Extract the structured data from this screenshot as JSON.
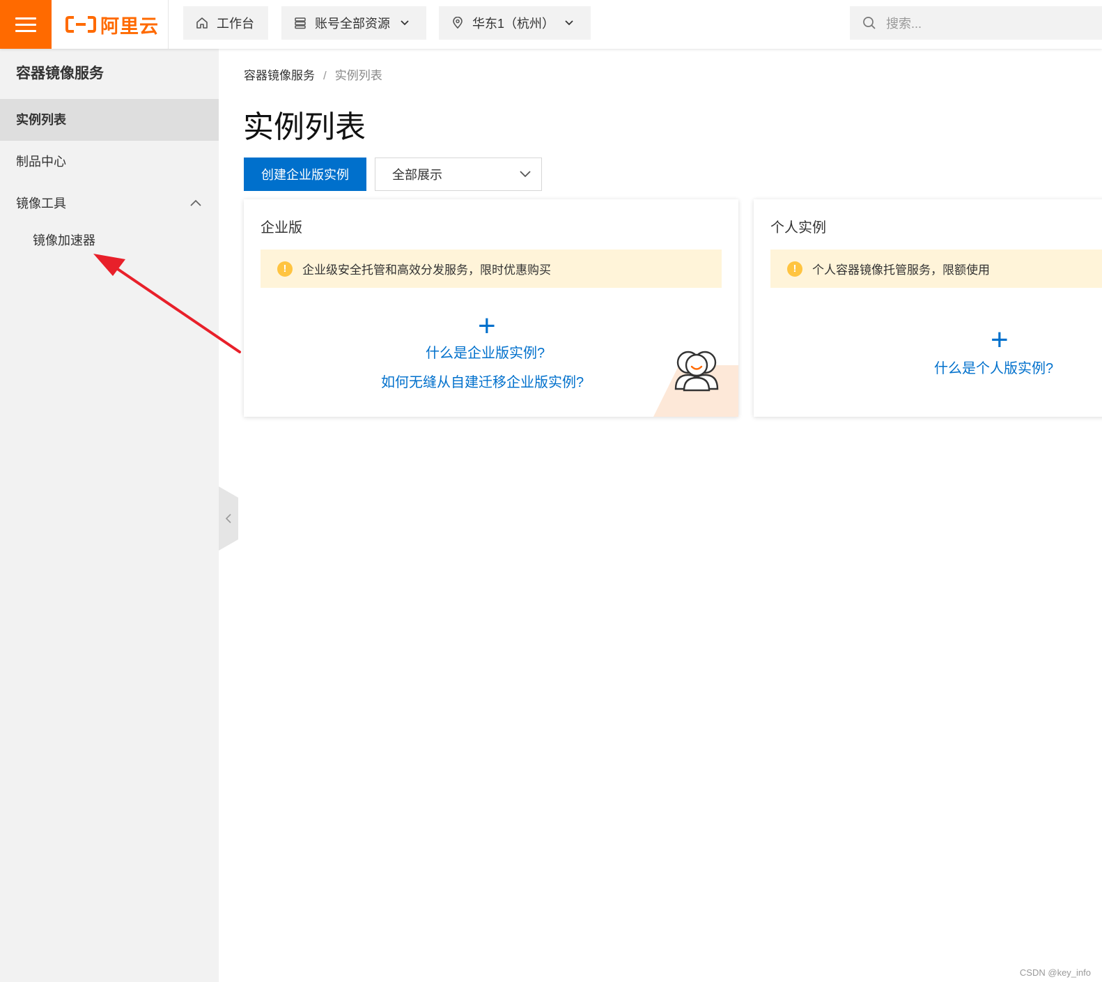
{
  "topbar": {
    "brand": "阿里云",
    "workbench": "工作台",
    "resources": "账号全部资源",
    "region": "华东1（杭州）",
    "search_placeholder": "搜索..."
  },
  "sidebar": {
    "title": "容器镜像服务",
    "items": [
      {
        "label": "实例列表",
        "active": true
      },
      {
        "label": "制品中心",
        "active": false
      },
      {
        "label": "镜像工具",
        "active": false,
        "expanded": true
      }
    ],
    "subitems": [
      {
        "label": "镜像加速器"
      }
    ]
  },
  "breadcrumb": {
    "root": "容器镜像服务",
    "separator": "/",
    "current": "实例列表"
  },
  "page": {
    "title": "实例列表",
    "create_button": "创建企业版实例",
    "filter_value": "全部展示"
  },
  "cards": {
    "enterprise": {
      "title": "企业版",
      "notice": "企业级安全托管和高效分发服务，限时优惠购买",
      "link1": "什么是企业版实例?",
      "link2": "如何无缝从自建迁移企业版实例?"
    },
    "personal": {
      "title": "个人实例",
      "notice": "个人容器镜像托管服务，限额使用",
      "link1": "什么是个人版实例?"
    }
  },
  "watermark": "CSDN @key_info",
  "colors": {
    "brand": "#ff6a00",
    "primary": "#0070cc",
    "notice_bg": "#fff4d9",
    "warning": "#ffc440",
    "annotation_arrow": "#e8202a"
  },
  "icons": {
    "menu": "hamburger-icon",
    "home": "home-icon",
    "resources": "stack-icon",
    "region": "location-pin-icon",
    "search": "search-icon",
    "collapse": "chevron-left-icon"
  }
}
